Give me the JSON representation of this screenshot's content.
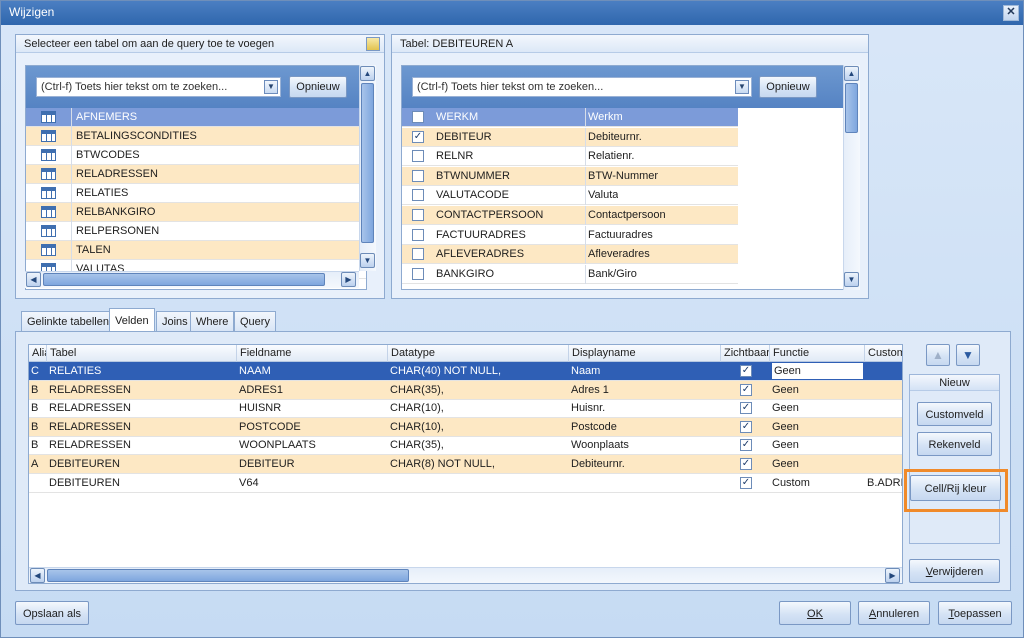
{
  "window": {
    "title": "Wijzigen",
    "close": "✕"
  },
  "left_panel": {
    "title": "Selecteer een tabel om aan de query toe te voegen",
    "search_placeholder": "(Ctrl-f) Toets hier tekst om te zoeken...",
    "reset_label": "Opnieuw",
    "tables": [
      "AFNEMERS",
      "BETALINGSCONDITIES",
      "BTWCODES",
      "RELADRESSEN",
      "RELATIES",
      "RELBANKGIRO",
      "RELPERSONEN",
      "TALEN",
      "VALUTAS"
    ]
  },
  "right_panel": {
    "title": "Tabel: DEBITEUREN A",
    "search_placeholder": "(Ctrl-f) Toets hier tekst om te zoeken...",
    "reset_label": "Opnieuw",
    "fields": [
      {
        "name": "WERKM",
        "display": "Werkm",
        "checked": false
      },
      {
        "name": "DEBITEUR",
        "display": "Debiteurnr.",
        "checked": true
      },
      {
        "name": "RELNR",
        "display": "Relatienr.",
        "checked": false
      },
      {
        "name": "BTWNUMMER",
        "display": "BTW-Nummer",
        "checked": false
      },
      {
        "name": "VALUTACODE",
        "display": "Valuta",
        "checked": false
      },
      {
        "name": "CONTACTPERSOON",
        "display": "Contactpersoon",
        "checked": false
      },
      {
        "name": "FACTUURADRES",
        "display": "Factuuradres",
        "checked": false
      },
      {
        "name": "AFLEVERADRES",
        "display": "Afleveradres",
        "checked": false
      },
      {
        "name": "BANKGIRO",
        "display": "Bank/Giro",
        "checked": false
      }
    ]
  },
  "tabs": [
    "Gelinkte tabellen",
    "Velden",
    "Joins",
    "Where",
    "Query"
  ],
  "fields_grid": {
    "columns": [
      "Alia",
      "Tabel",
      "Fieldname",
      "Datatype",
      "Displayname",
      "Zichtbaar",
      "Functie",
      "Custom"
    ],
    "rows": [
      {
        "alias": "C",
        "tabel": "RELATIES",
        "field": "NAAM",
        "type": "CHAR(40) NOT NULL,",
        "display": "Naam",
        "visible": true,
        "func": "Geen",
        "custom": ""
      },
      {
        "alias": "B",
        "tabel": "RELADRESSEN",
        "field": "ADRES1",
        "type": "CHAR(35),",
        "display": "Adres 1",
        "visible": true,
        "func": "Geen",
        "custom": ""
      },
      {
        "alias": "B",
        "tabel": "RELADRESSEN",
        "field": "HUISNR",
        "type": "CHAR(10),",
        "display": "Huisnr.",
        "visible": true,
        "func": "Geen",
        "custom": ""
      },
      {
        "alias": "B",
        "tabel": "RELADRESSEN",
        "field": "POSTCODE",
        "type": "CHAR(10),",
        "display": "Postcode",
        "visible": true,
        "func": "Geen",
        "custom": ""
      },
      {
        "alias": "B",
        "tabel": "RELADRESSEN",
        "field": "WOONPLAATS",
        "type": "CHAR(35),",
        "display": "Woonplaats",
        "visible": true,
        "func": "Geen",
        "custom": ""
      },
      {
        "alias": "A",
        "tabel": "DEBITEUREN",
        "field": "DEBITEUR",
        "type": "CHAR(8) NOT NULL,",
        "display": "Debiteurnr.",
        "visible": true,
        "func": "Geen",
        "custom": ""
      },
      {
        "alias": "",
        "tabel": "DEBITEUREN",
        "field": "V64",
        "type": "",
        "display": "",
        "visible": true,
        "func": "Custom",
        "custom": "B.ADRE"
      }
    ]
  },
  "side": {
    "group_title": "Nieuw",
    "customveld": "Customveld",
    "rekenveld": "Rekenveld",
    "cellrij": "Cell/Rij kleur",
    "verwijderen": "Verwijderen"
  },
  "footer": {
    "save_as": "Opslaan als",
    "ok": "OK",
    "cancel": "Annuleren",
    "apply": "Toepassen"
  },
  "colors": {
    "highlight": "#f08a2a",
    "selected_row": "#2f5fb5",
    "alt_row": "#fde8c4"
  }
}
